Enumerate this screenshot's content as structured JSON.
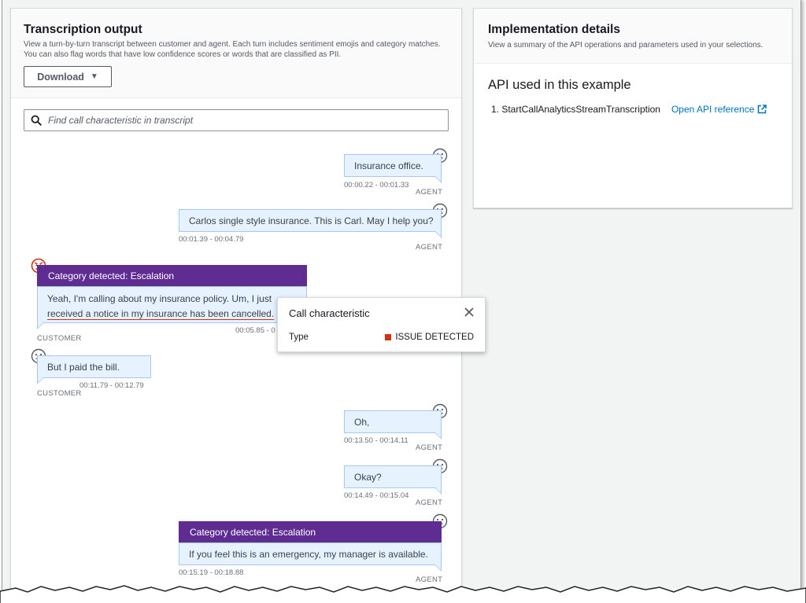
{
  "left": {
    "title": "Transcription output",
    "description": "View a turn-by-turn transcript between customer and agent. Each turn includes sentiment emojis and category matches. You can also flag words that have low confidence scores or words that are classified as PII.",
    "download_label": "Download",
    "search_placeholder": "Find call characteristic in transcript"
  },
  "turns": [
    {
      "speaker": "AGENT",
      "text": "Insurance office.",
      "time": "00:00.22 - 00:01.33",
      "sentiment": "neutral-icon"
    },
    {
      "speaker": "AGENT",
      "text": "Carlos single style insurance. This is Carl. May I help you?",
      "time": "00:01.39 - 00:04.79",
      "sentiment": "neutral-icon"
    },
    {
      "speaker": "CUSTOMER",
      "category": "Category detected: Escalation",
      "text_line1": "Yeah, I'm calling about my insurance policy. Um, I just",
      "text_line2": "received a notice in my insurance has been cancelled.",
      "time": "00:05.85 - 0",
      "sentiment": "angry-icon"
    },
    {
      "speaker": "CUSTOMER",
      "text": "But I paid the bill.",
      "time": "00:11.79 - 00:12.79",
      "sentiment": "neutral-icon"
    },
    {
      "speaker": "AGENT",
      "text": "Oh,",
      "time": "00:13.50 - 00:14.11",
      "sentiment": "neutral-icon"
    },
    {
      "speaker": "AGENT",
      "text": "Okay?",
      "time": "00:14.49 - 00:15.04",
      "sentiment": "neutral-icon"
    },
    {
      "speaker": "AGENT",
      "category": "Category detected: Escalation",
      "text": "If you feel this is an emergency, my manager is available.",
      "time": "00:15.19 - 00:18.88",
      "sentiment": "neutral-icon"
    }
  ],
  "popover": {
    "title": "Call characteristic",
    "key": "Type",
    "value": "ISSUE DETECTED",
    "status_color": "#d13212"
  },
  "right": {
    "title": "Implementation details",
    "description": "View a summary of the API operations and parameters used in your selections.",
    "api_heading": "API used in this example",
    "api_item": "1. StartCallAnalyticsStreamTranscription",
    "api_link": "Open API reference"
  },
  "colors": {
    "category_bar": "#5f2c91",
    "bubble_bg": "#e6f2ff",
    "link": "#0073bb",
    "angry": "#d13212"
  }
}
